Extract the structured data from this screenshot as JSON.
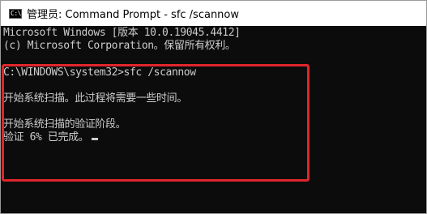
{
  "window": {
    "title": "管理员: Command Prompt - sfc  /scannow",
    "icon": "cmd-icon",
    "icon_text": "C:\\"
  },
  "console": {
    "lines": [
      "Microsoft Windows [版本 10.0.19045.4412]",
      "(c) Microsoft Corporation。保留所有权利。",
      "C:\\WINDOWS\\system32>sfc /scannow",
      "开始系统扫描。此过程将需要一些时间。",
      "开始系统扫描的验证阶段。",
      "验证 6% 已完成。"
    ],
    "progress_percent": 6
  },
  "colors": {
    "console_background": "#0c0c0c",
    "console_text": "#cccccc",
    "titlebar_background": "#ffffff",
    "highlight_border": "#e0262b"
  }
}
